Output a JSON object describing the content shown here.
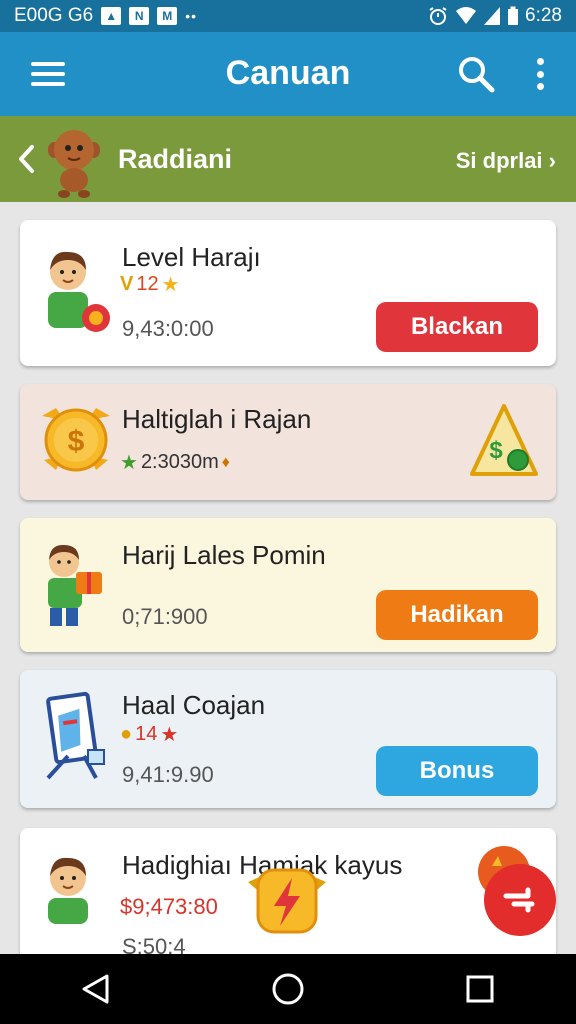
{
  "status_bar": {
    "left_text": "E00G G6",
    "time": "6:28",
    "icons": [
      "photo-icon",
      "n-notification-icon",
      "m-notification-icon",
      "more-notifications-icon",
      "alarm-icon",
      "wifi-icon",
      "signal-icon",
      "battery-icon"
    ]
  },
  "app_bar": {
    "title": "Canuan",
    "icons": [
      "menu-icon",
      "search-icon",
      "more-vert-icon"
    ]
  },
  "sub_header": {
    "title": "Raddiani",
    "link_label": "Si dprlai",
    "icons": [
      "chevron-left-icon",
      "mascot-icon",
      "chevron-right-icon"
    ]
  },
  "cards": [
    {
      "title": "Level Harajı",
      "meta_text": "12",
      "amount": "9,43:0:00",
      "button_label": "Blackan",
      "colors": {
        "bg": "#ffffff",
        "button": "#e0353a",
        "meta": "#d84a1e"
      }
    },
    {
      "title": "Haltiglah i Rajan",
      "meta_text": "2:3030m",
      "amount": "",
      "button_label": "",
      "colors": {
        "bg": "#f2e3dd"
      }
    },
    {
      "title": "Harij Lales Pomin",
      "meta_text": "",
      "amount": "0;71:900",
      "button_label": "Hadikan",
      "colors": {
        "bg": "#fbf7df",
        "button": "#ee7b14"
      }
    },
    {
      "title": "Haal Coajan",
      "meta_text": "14",
      "amount": "9,41:9.90",
      "button_label": "Bonus",
      "colors": {
        "bg": "#ecf1f6",
        "button": "#2ea6df",
        "meta": "#d8342a"
      }
    },
    {
      "title": "Hadighiaı Hamiak kayus",
      "meta_text": "$9;473:80",
      "amount": "S:50:4",
      "button_label": "",
      "colors": {
        "bg": "#ffffff",
        "meta": "#d8342a"
      }
    }
  ],
  "nav_bar": {
    "icons": [
      "back-triangle-icon",
      "home-circle-icon",
      "recents-square-icon"
    ]
  },
  "colors": {
    "status_bar": "#18709c",
    "app_bar": "#2190c6",
    "sub_header": "#7a9a3c",
    "background": "#e6e6e6"
  }
}
